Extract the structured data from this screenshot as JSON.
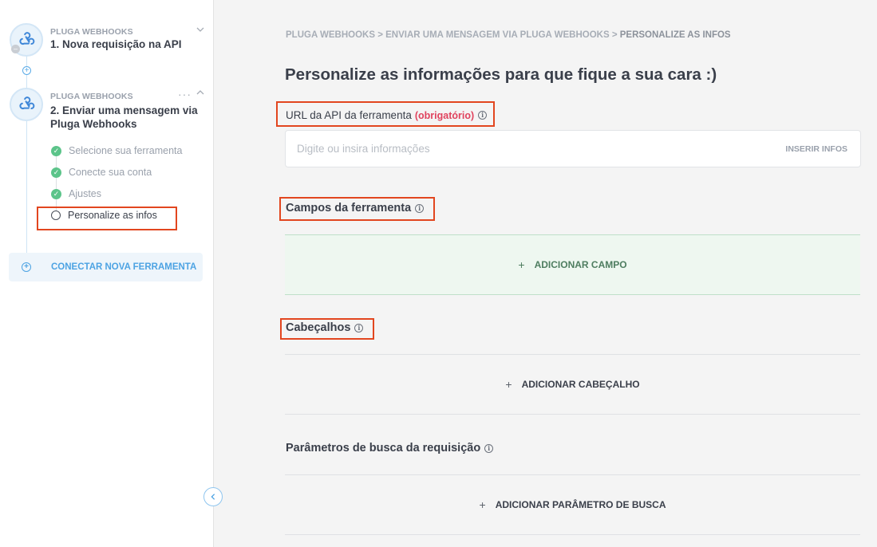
{
  "sidebar": {
    "step1": {
      "provider": "PLUGA WEBHOOKS",
      "title": "1. Nova requisição na API"
    },
    "step2": {
      "provider": "PLUGA WEBHOOKS",
      "title": "2. Enviar uma mensagem via Pluga Webhooks",
      "substeps": [
        {
          "label": "Selecione sua ferramenta",
          "status": "done"
        },
        {
          "label": "Conecte sua conta",
          "status": "done"
        },
        {
          "label": "Ajustes",
          "status": "done"
        },
        {
          "label": "Personalize as infos",
          "status": "current"
        }
      ]
    },
    "connect_label": "CONECTAR NOVA FERRAMENTA"
  },
  "breadcrumb": {
    "part1": "PLUGA WEBHOOKS",
    "sep": " > ",
    "part2": "ENVIAR UMA MENSAGEM VIA PLUGA WEBHOOKS",
    "part3": "PERSONALIZE AS INFOS"
  },
  "main": {
    "title": "Personalize as informações para que fique a sua cara :)",
    "url_field": {
      "label": "URL da API da ferramenta",
      "required": "(obrigatório)",
      "placeholder": "Digite ou insira informações",
      "insert_label": "INSERIR INFOS"
    },
    "sections": [
      {
        "title": "Campos da ferramenta",
        "add_label": "ADICIONAR CAMPO"
      },
      {
        "title": "Cabeçalhos",
        "add_label": "ADICIONAR CABEÇALHO"
      },
      {
        "title": "Parâmetros de busca da requisição",
        "add_label": "ADICIONAR PARÂMETRO DE BUSCA"
      }
    ]
  },
  "colors": {
    "accent": "#4da3e3",
    "success": "#5cc48a",
    "required": "#e0435e",
    "highlight": "#e2461f"
  },
  "icons": [
    "webhook-icon",
    "chevron-down-icon",
    "chevron-up-icon",
    "more-icon",
    "plus-circle-icon",
    "check-circle-icon",
    "radio-icon",
    "info-icon",
    "chevron-left-icon"
  ]
}
